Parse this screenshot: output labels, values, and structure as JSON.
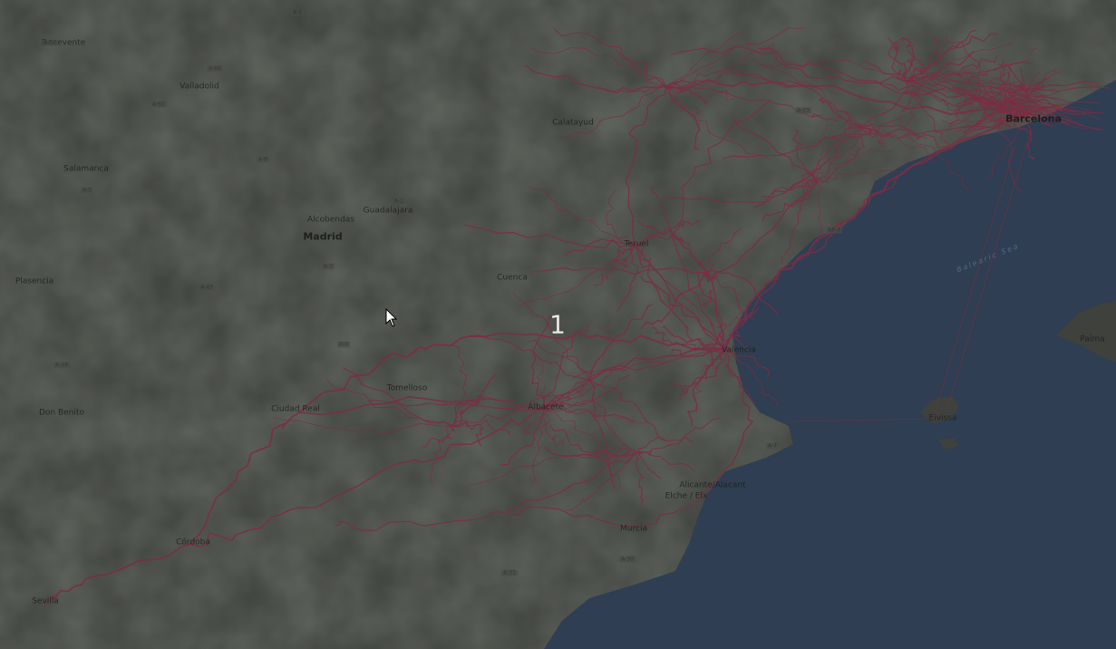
{
  "map": {
    "cities": [
      {
        "id": "benevente",
        "name": "Benevente"
      },
      {
        "id": "valladolid",
        "name": "Valladolid"
      },
      {
        "id": "salamanca",
        "name": "Salamanca"
      },
      {
        "id": "alcobendas",
        "name": "Alcobendas"
      },
      {
        "id": "guadalajara",
        "name": "Guadalajara"
      },
      {
        "id": "madrid",
        "name": "Madrid"
      },
      {
        "id": "plasencia",
        "name": "Plasencia"
      },
      {
        "id": "cuenca",
        "name": "Cuenca"
      },
      {
        "id": "teruel",
        "name": "Teruel"
      },
      {
        "id": "calatayud",
        "name": "Calatayud"
      },
      {
        "id": "barcelona",
        "name": "Barcelona"
      },
      {
        "id": "valencia",
        "name": "Valencia"
      },
      {
        "id": "albacete",
        "name": "Albacete"
      },
      {
        "id": "ciudad-real",
        "name": "Ciudad Real"
      },
      {
        "id": "tomelloso",
        "name": "Tomelloso"
      },
      {
        "id": "don-benito",
        "name": "Don Benito"
      },
      {
        "id": "cordoba",
        "name": "Córdoba"
      },
      {
        "id": "sevilla",
        "name": "Sevilla"
      },
      {
        "id": "murcia",
        "name": "Murcia"
      },
      {
        "id": "alicante",
        "name": "Alicante/Alacant"
      },
      {
        "id": "elche",
        "name": "Elche / Elx"
      },
      {
        "id": "ibiza",
        "name": "Eivissa"
      },
      {
        "id": "palma",
        "name": "Palma"
      }
    ],
    "sea_label": "Balearic Sea",
    "roads": [
      "A-52",
      "A-66",
      "A-62",
      "A-6",
      "A-1",
      "A-2",
      "A-3",
      "A-4",
      "A-5",
      "A-23",
      "A-7",
      "AP-7",
      "A-30",
      "A-31",
      "A-43",
      "A-49"
    ],
    "route_color": "#7a2e44",
    "sea_color": "#2f3e52",
    "land_color": "#3d403b"
  },
  "overlay": {
    "count": "1"
  }
}
